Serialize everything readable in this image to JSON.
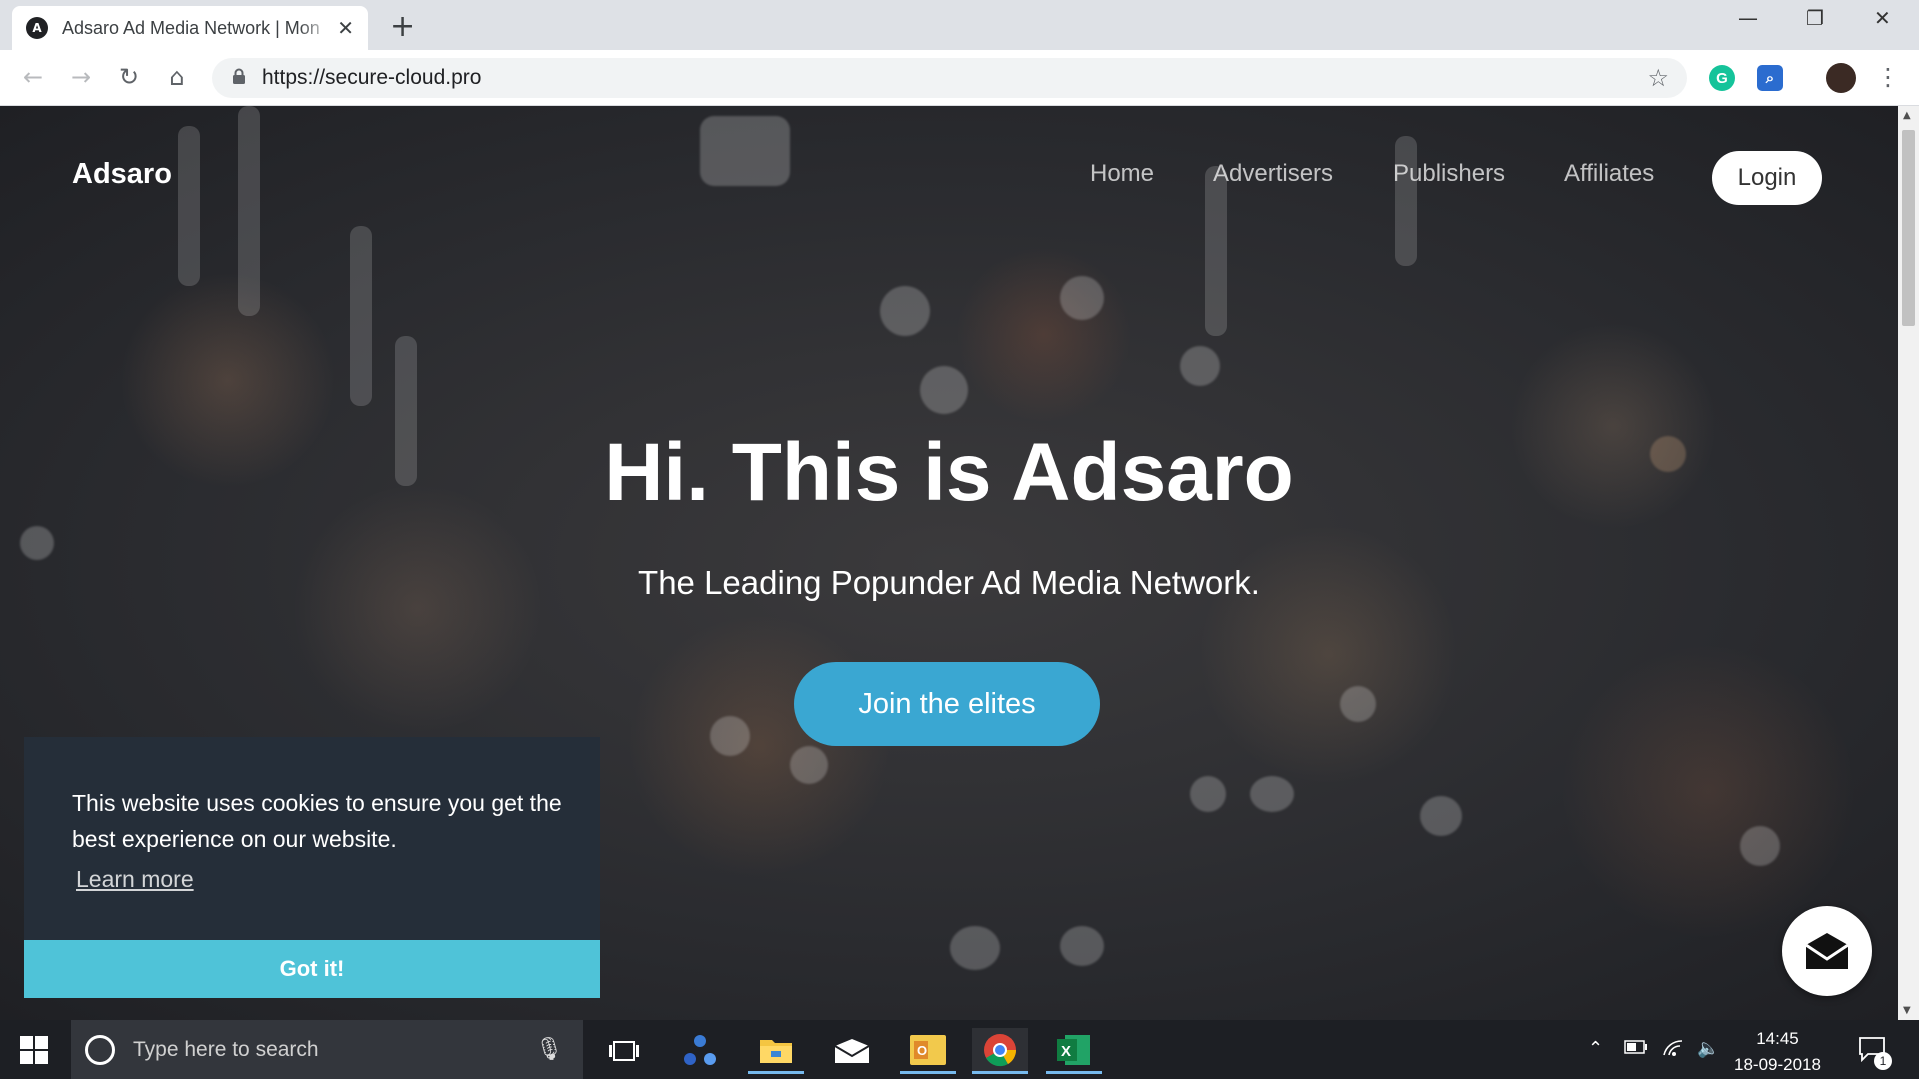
{
  "browser": {
    "tab_title": "Adsaro Ad Media Network | Mon",
    "tab_favicon": "A",
    "close_glyph": "✕",
    "newtab_glyph": "+",
    "url": "https://secure-cloud.pro",
    "window_controls": {
      "minimize": "—",
      "restore": "❐",
      "close": "✕"
    },
    "nav_glyphs": {
      "back": "←",
      "forward": "→",
      "reload": "↻",
      "home": "⌂",
      "star": "☆",
      "menu": "⋮",
      "lock": "🔒"
    },
    "extensions": [
      {
        "name": "grammarly-extension",
        "letter": "G",
        "color": "#15c39a"
      },
      {
        "name": "search-extension",
        "letter": "⌕",
        "color": "#2b6ccf"
      }
    ]
  },
  "site": {
    "brand": "Adsaro",
    "nav": [
      "Home",
      "Advertisers",
      "Publishers",
      "Affiliates"
    ],
    "login": "Login",
    "hero_title": "Hi. This is Adsaro",
    "hero_subtitle": "The Leading Popunder Ad Media Network.",
    "cta": "Join the elites",
    "cookie": {
      "message": "This website uses cookies to ensure you get the best experience on our website.",
      "learn_more": "Learn more",
      "accept": "Got it!"
    },
    "accent_color": "#3aa7d2",
    "cookie_button_color": "#4fc3d8"
  },
  "taskbar": {
    "search_placeholder": "Type here to search",
    "time": "14:45",
    "date": "18-09-2018",
    "notification_count": "1",
    "apps": [
      "task-view",
      "app-blue-icon",
      "file-explorer",
      "mail",
      "outlook",
      "chrome",
      "excel"
    ]
  }
}
